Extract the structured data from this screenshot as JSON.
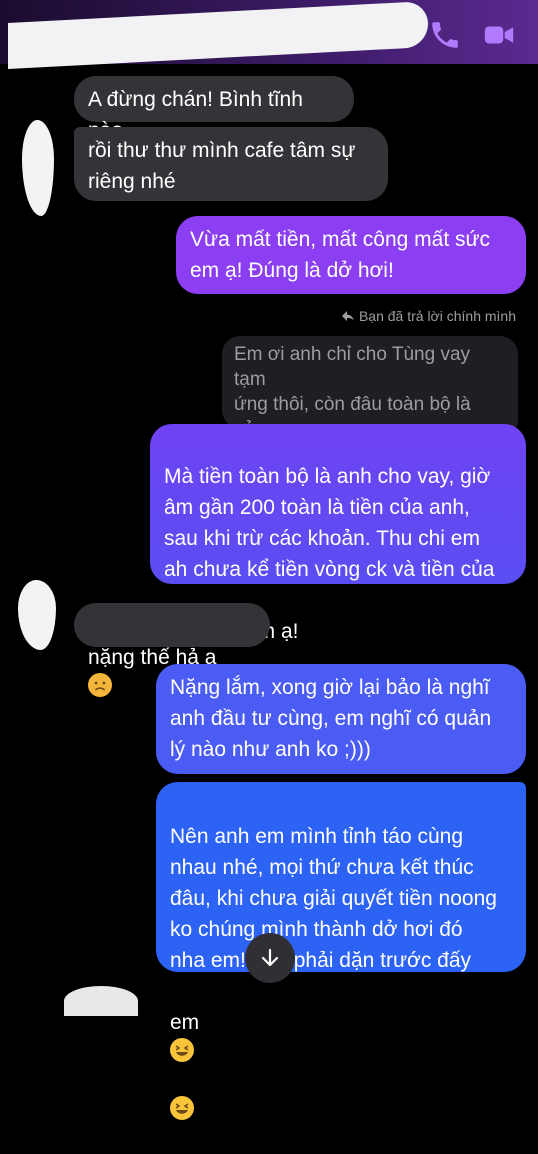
{
  "header": {
    "contact_name_redacted": true,
    "icons": [
      "phone-icon",
      "video-call-icon"
    ],
    "accent": "#a86cf2"
  },
  "messages": [
    {
      "id": "m1",
      "side": "in",
      "text": "A đừng chán! Bình tĩnh nào"
    },
    {
      "id": "m2",
      "side": "in",
      "text": "rồi thư thư mình cafe tâm sự\nriêng nhé"
    },
    {
      "id": "m3",
      "side": "out",
      "text": "Vừa mất tiền, mất công mất sức\nem ạ! Đúng là dở hơi!"
    },
    {
      "id": "m4",
      "side": "out",
      "text": "Mà tiền toàn bộ là anh cho vay, giờ\nâm gần 200 toàn là tiền của anh,\nsau khi trừ các khoản. Thu chi em\nah chưa kể tiền vòng ck và tiền của",
      "tail": "em ạ!"
    },
    {
      "id": "m5",
      "side": "in",
      "text": "nặng thế hả a"
    },
    {
      "id": "m6",
      "side": "out",
      "text": "Nặng lắm, xong giờ lại bảo là nghĩ\nanh đầu tư cùng, em nghĩ có quản\nlý nào như anh ko ;)))"
    },
    {
      "id": "m7",
      "side": "out",
      "text": "Nên anh em mình tỉnh táo cùng\nnhau nhé, mọi thứ chưa kết thúc\nđâu, khi chưa giải quyết tiền noong\nko chúng mình thành dở hơi đó\nnha em! Anh phải dặn trước đấy",
      "tail": "em"
    }
  ],
  "reply": {
    "label": "Bạn đã trả lời chính mình",
    "quoted": "Em ơi anh chỉ cho Tùng vay tạm\nứng thôi, còn đâu toàn bộ là của\nTùng nhé, anh ko có nhu cầu đ..."
  },
  "colors": {
    "incoming_bubble": "#333437",
    "outgoing_top": "#8a3ff0",
    "outgoing_bottom": "#2f5df5"
  }
}
